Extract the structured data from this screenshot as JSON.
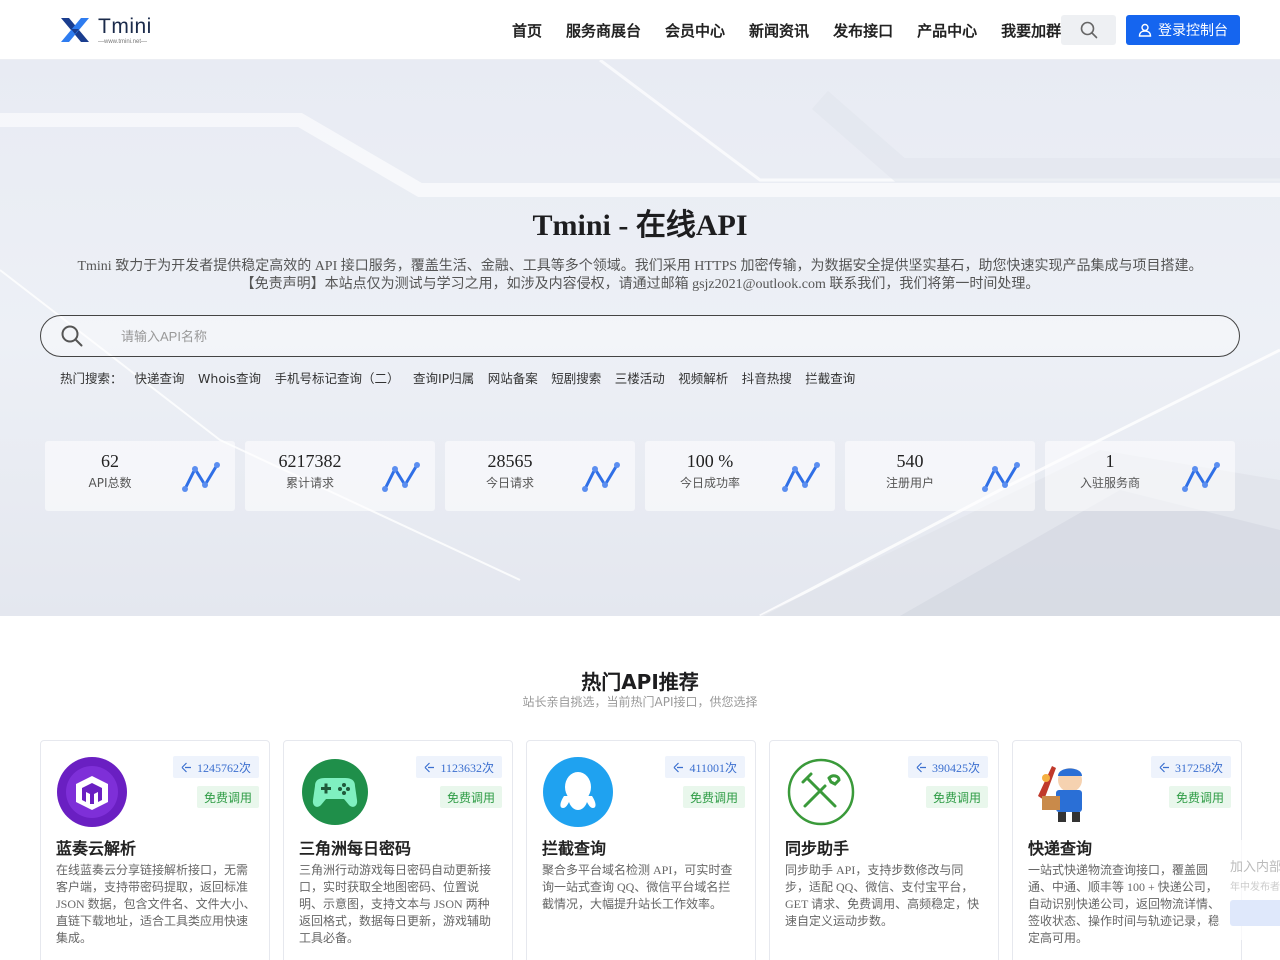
{
  "header": {
    "brand": "Tmini",
    "brand_url": "—www.tmini.net—",
    "nav": [
      "首页",
      "服务商展台",
      "会员中心",
      "新闻资讯",
      "发布接口",
      "产品中心",
      "我要加群"
    ],
    "login_label": "登录控制台",
    "search_icon": "search-icon"
  },
  "hero": {
    "title": "Tmini - 在线API",
    "desc_line1": "Tmini 致力于为开发者提供稳定高效的 API 接口服务，覆盖生活、金融、工具等多个领域。我们采用 HTTPS 加密传输，为数据安全提供坚实基石，助您快速实现产品集成与项目搭建。",
    "desc_line2": "【免责声明】本站点仅为测试与学习之用，如涉及内容侵权，请通过邮箱 gsjz2021@outlook.com 联系我们，我们将第一时间处理。",
    "search_placeholder": "请输入API名称",
    "hot_label": "热门搜索：",
    "hot_items": [
      "快递查询",
      "Whois查询",
      "手机号标记查询（二）",
      "查询IP归属",
      "网站备案",
      "短剧搜索",
      "三楼活动",
      "视频解析",
      "抖音热搜",
      "拦截查询"
    ],
    "stats": [
      {
        "value": "62",
        "label": "API总数"
      },
      {
        "value": "6217382",
        "label": "累计请求"
      },
      {
        "value": "28565",
        "label": "今日请求"
      },
      {
        "value": "100 %",
        "label": "今日成功率"
      },
      {
        "value": "540",
        "label": "注册用户"
      },
      {
        "value": "1",
        "label": "入驻服务商"
      }
    ]
  },
  "section": {
    "title": "热门API推荐",
    "subtitle": "站长亲自挑选，当前热门API接口，供您选择"
  },
  "cards": [
    {
      "name": "蓝奏云解析",
      "count": "1245762次",
      "free": "免费调用",
      "desc": "在线蓝奏云分享链接解析接口，无需客户端，支持带密码提取，返回标准 JSON 数据，包含文件名、文件大小、直链下载地址，适合工具类应用快速集成。"
    },
    {
      "name": "三角洲每日密码",
      "count": "1123632次",
      "free": "免费调用",
      "desc": "三角洲行动游戏每日密码自动更新接口，实时获取全地图密码、位置说明、示意图，支持文本与 JSON 两种返回格式，数据每日更新，游戏辅助工具必备。"
    },
    {
      "name": "拦截查询",
      "count": "411001次",
      "free": "免费调用",
      "desc": "聚合多平台域名检测 API，可实时查询一站式查询 QQ、微信平台域名拦截情况，大幅提升站长工作效率。"
    },
    {
      "name": "同步助手",
      "count": "390425次",
      "free": "免费调用",
      "desc": "同步助手 API，支持步数修改与同步，适配 QQ、微信、支付宝平台，GET 请求、免费调用、高频稳定，快速自定义运动步数。"
    },
    {
      "name": "快递查询",
      "count": "317258次",
      "free": "免费调用",
      "desc": "一站式快递物流查询接口，覆盖圆通、中通、顺丰等 100 + 快递公司，自动识别快递公司，返回物流详情、签收状态、操作时间与轨迹记录，稳定高可用。"
    }
  ],
  "float": {
    "title": "加入内部",
    "sub": "年中发布者"
  },
  "colors": {
    "primary": "#1565ef",
    "free_green": "#2e9c45",
    "count_blue": "#3b6fcf"
  }
}
